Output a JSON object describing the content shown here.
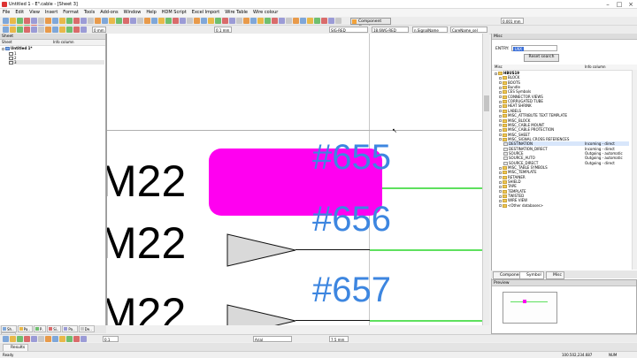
{
  "window": {
    "title": "Untitled 1 - E³.cable - [Sheet 3]"
  },
  "menu": [
    "File",
    "Edit",
    "View",
    "Insert",
    "Format",
    "Tools",
    "Add-ons",
    "Window",
    "Help",
    "HDM Script",
    "Excel Import",
    "Wire Table",
    "Wire colour"
  ],
  "toolbar": {
    "line_width": "0 mm",
    "zoom_level": "0.1 mm",
    "signal_combo": "SIG-RED",
    "device_combo": "18.6WG-RED",
    "sig_name_combo": "n.SignalName",
    "core_name_combo": "CoreName_sel",
    "component_cloud": "Component Cloud",
    "right_combo": "0.001 mm"
  },
  "left_panel": {
    "title": "Sheet",
    "columns": [
      "Sheet",
      "Info column"
    ],
    "project": "Untitled 1*",
    "sheets": [
      "1",
      "2",
      "3"
    ]
  },
  "right_panel": {
    "title": "Misc",
    "entry_label": "ENTRY:",
    "entry_value": "LNX",
    "reset_button": "Reset search",
    "columns": [
      "Misc",
      "Info column"
    ],
    "tree": [
      {
        "label": "HBUS19",
        "info": "",
        "level": 0
      },
      {
        "label": "BLOCK",
        "info": "",
        "level": 1
      },
      {
        "label": "BOOTS",
        "info": "",
        "level": 1
      },
      {
        "label": "Bundle",
        "info": "",
        "level": 1
      },
      {
        "label": "CES Symbols",
        "info": "",
        "level": 1
      },
      {
        "label": "CONNECTOR VIEWS",
        "info": "",
        "level": 1
      },
      {
        "label": "CORRUGATED TUBE",
        "info": "",
        "level": 1
      },
      {
        "label": "HEAT SHRINK",
        "info": "",
        "level": 1
      },
      {
        "label": "LABELS",
        "info": "",
        "level": 1
      },
      {
        "label": "MISC_ATTRIBUTE TEXT TEMPLATE",
        "info": "",
        "level": 1
      },
      {
        "label": "MISC_BLOCK",
        "info": "",
        "level": 1
      },
      {
        "label": "MISC_CABLE MOUNT",
        "info": "",
        "level": 1
      },
      {
        "label": "MISC_CABLE PROTECTION",
        "info": "",
        "level": 1
      },
      {
        "label": "MISC_SHEET",
        "info": "",
        "level": 1
      },
      {
        "label": "MISC_SIGNAL CROSS REFERENCES",
        "info": "",
        "level": 1
      },
      {
        "label": "DESTINATION",
        "info": "Incoming - direct",
        "level": 2,
        "selected": true
      },
      {
        "label": "DESTINATION_DIRECT",
        "info": "Incoming - direct",
        "level": 2
      },
      {
        "label": "SOURCE",
        "info": "Outgoing - automatic",
        "level": 2
      },
      {
        "label": "SOURCE_AUTO",
        "info": "Outgoing - automatic",
        "level": 2
      },
      {
        "label": "SOURCE_DIRECT",
        "info": "Outgoing - direct",
        "level": 2
      },
      {
        "label": "MISC_TABLE SYMBOLS",
        "info": "",
        "level": 1
      },
      {
        "label": "MISC_TEMPLATE",
        "info": "",
        "level": 1
      },
      {
        "label": "RETAINER",
        "info": "",
        "level": 1
      },
      {
        "label": "SHIELD",
        "info": "",
        "level": 1
      },
      {
        "label": "TAPE",
        "info": "",
        "level": 1
      },
      {
        "label": "TEMPLATE",
        "info": "",
        "level": 1
      },
      {
        "label": "TWISTED",
        "info": "",
        "level": 1
      },
      {
        "label": "WIRE VIEW",
        "info": "",
        "level": 1
      },
      {
        "label": "<Other databases>",
        "info": "",
        "level": 1
      }
    ],
    "tabs": [
      "Component",
      "Symbol",
      "Misc"
    ],
    "preview_title": "Preview"
  },
  "canvas": {
    "rows": [
      {
        "conn": "M22",
        "tag": "#655",
        "highlight": true
      },
      {
        "conn": "M22",
        "tag": "#656",
        "highlight": false
      },
      {
        "conn": "M22",
        "tag": "#657",
        "highlight": false
      }
    ],
    "highlight_color": "#ff00f0",
    "wire_color": "#5ee05e",
    "tag_color": "#3d86e0"
  },
  "bottom_tabs": [
    "Sh..",
    "Pa..",
    "P..",
    "Si..",
    "Pa..",
    "De..",
    "Pa.."
  ],
  "bottom_toolbar": {
    "width": "0.1 mm",
    "font": "Arial",
    "size": "7.5 mm"
  },
  "output_tab": "Results",
  "status": {
    "left": "Ready",
    "right": "100.502,234.687",
    "mode": "NUM"
  }
}
